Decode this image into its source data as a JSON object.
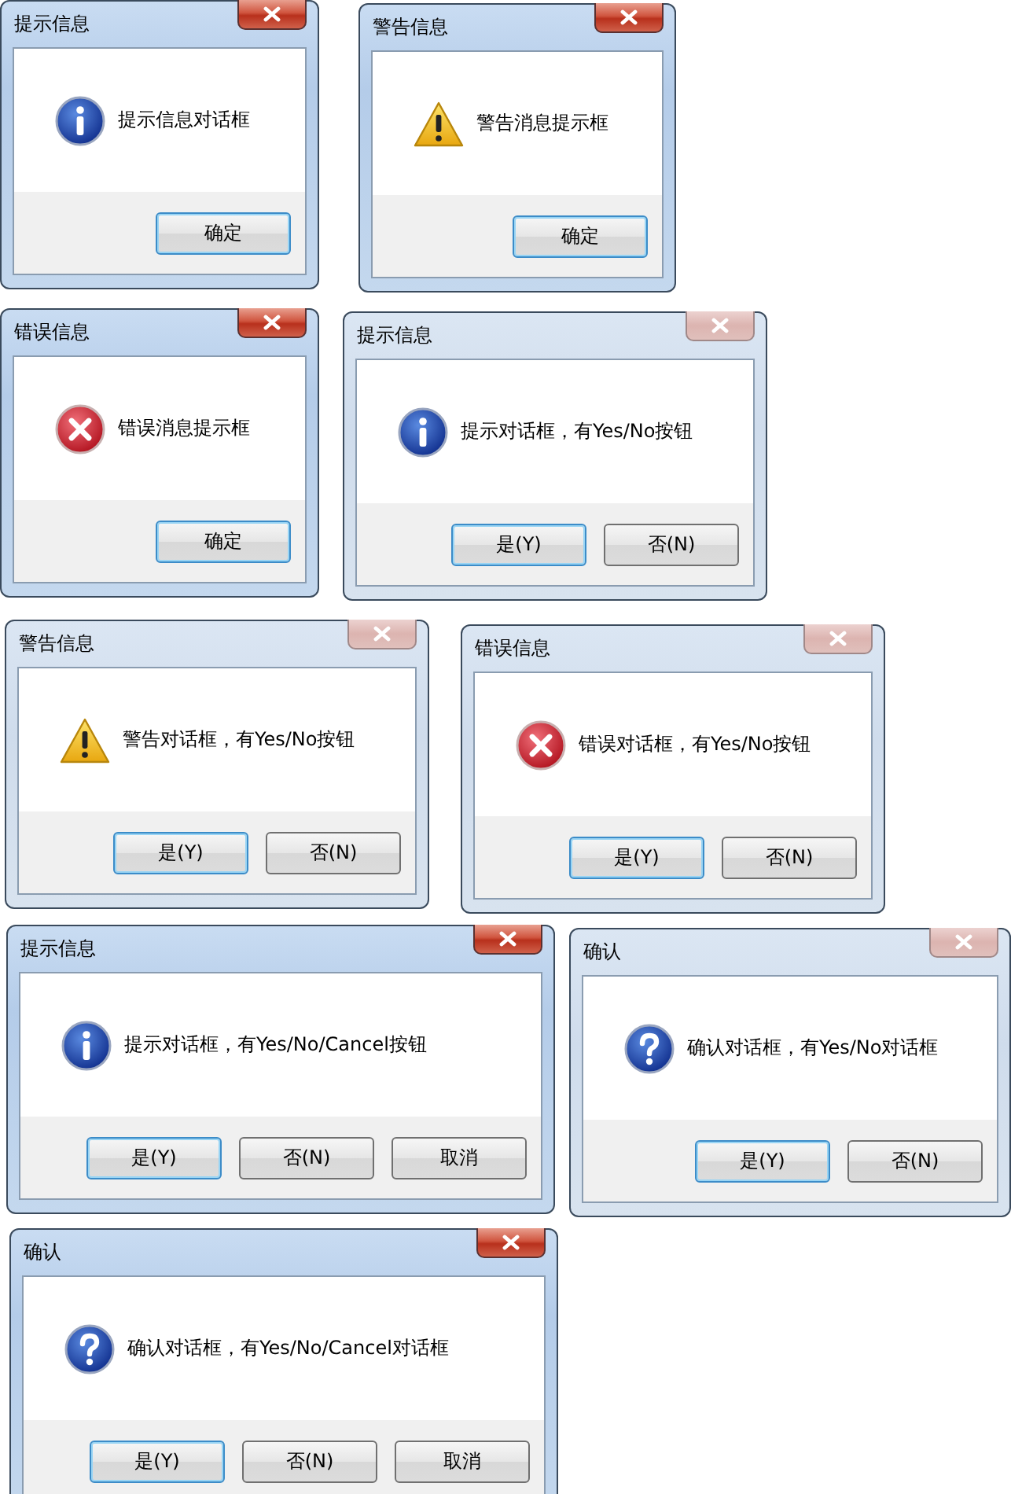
{
  "dialogs": [
    {
      "title": "提示信息",
      "kind": "info",
      "message": "提示信息对话框",
      "active": true,
      "buttons": [
        {
          "label": "确定",
          "default": true
        }
      ]
    },
    {
      "title": "警告信息",
      "kind": "warning",
      "message": "警告消息提示框",
      "active": true,
      "buttons": [
        {
          "label": "确定",
          "default": true
        }
      ]
    },
    {
      "title": "错误信息",
      "kind": "error",
      "message": "错误消息提示框",
      "active": true,
      "buttons": [
        {
          "label": "确定",
          "default": true
        }
      ]
    },
    {
      "title": "提示信息",
      "kind": "info",
      "message": "提示对话框，有Yes/No按钮",
      "active": false,
      "buttons": [
        {
          "label": "是(Y)",
          "default": true
        },
        {
          "label": "否(N)",
          "default": false
        }
      ]
    },
    {
      "title": "警告信息",
      "kind": "warning",
      "message": "警告对话框，有Yes/No按钮",
      "active": false,
      "buttons": [
        {
          "label": "是(Y)",
          "default": true
        },
        {
          "label": "否(N)",
          "default": false
        }
      ]
    },
    {
      "title": "错误信息",
      "kind": "error",
      "message": "错误对话框，有Yes/No按钮",
      "active": false,
      "buttons": [
        {
          "label": "是(Y)",
          "default": true
        },
        {
          "label": "否(N)",
          "default": false
        }
      ]
    },
    {
      "title": "提示信息",
      "kind": "info",
      "message": "提示对话框，有Yes/No/Cancel按钮",
      "active": true,
      "buttons": [
        {
          "label": "是(Y)",
          "default": true
        },
        {
          "label": "否(N)",
          "default": false
        },
        {
          "label": "取消",
          "default": false
        }
      ]
    },
    {
      "title": "确认",
      "kind": "question",
      "message": "确认对话框，有Yes/No对话框",
      "active": false,
      "buttons": [
        {
          "label": "是(Y)",
          "default": true
        },
        {
          "label": "否(N)",
          "default": false
        }
      ]
    },
    {
      "title": "确认",
      "kind": "question",
      "message": "确认对话框，有Yes/No/Cancel对话框",
      "active": true,
      "buttons": [
        {
          "label": "是(Y)",
          "default": true
        },
        {
          "label": "否(N)",
          "default": false
        },
        {
          "label": "取消",
          "default": false
        }
      ]
    }
  ]
}
